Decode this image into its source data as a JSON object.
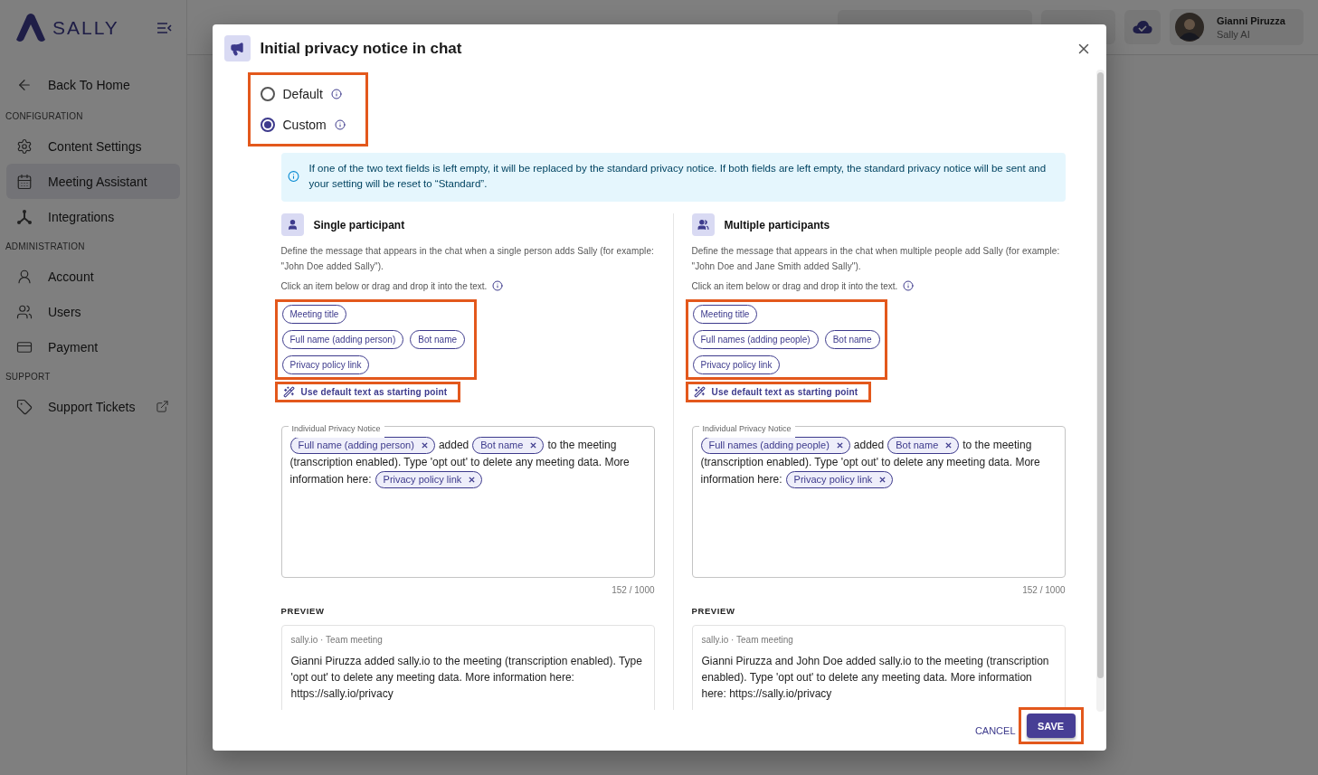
{
  "sidebar": {
    "logo": "SALLY",
    "back": {
      "label": "Back To Home"
    },
    "sections": [
      {
        "title": "CONFIGURATION",
        "items": [
          {
            "label": "Content Settings",
            "selected": false
          },
          {
            "label": "Meeting Assistant",
            "selected": true
          },
          {
            "label": "Integrations",
            "selected": false
          }
        ]
      },
      {
        "title": "ADMINISTRATION",
        "items": [
          {
            "label": "Account",
            "selected": false
          },
          {
            "label": "Users",
            "selected": false
          },
          {
            "label": "Payment",
            "selected": false
          }
        ]
      },
      {
        "title": "SUPPORT",
        "items": [
          {
            "label": "Support Tickets",
            "selected": false,
            "external": true
          }
        ]
      }
    ]
  },
  "topbar": {
    "user": {
      "name": "Gianni Piruzza",
      "role": "Sally AI"
    }
  },
  "dialog": {
    "title": "Initial privacy notice in chat",
    "radios_highlighted": true,
    "radios": [
      {
        "label": "Default",
        "selected": false
      },
      {
        "label": "Custom",
        "selected": true
      }
    ],
    "info": "If one of the two text fields is left empty, it will be replaced by the standard privacy notice. If both fields are left empty, the standard privacy notice will be sent and your setting will be reset to “Standard”.",
    "columns": [
      {
        "kind": "single",
        "title": "Single participant",
        "description": "Define the message that appears in the chat when a single person adds Sally (for example: \"John Doe added Sally\").",
        "hint": "Click an item below or drag and drop it into the text.",
        "tokens_highlighted": true,
        "tokens": [
          [
            "Meeting title"
          ],
          [
            "Full name (adding person)",
            "Bot name"
          ],
          [
            "Privacy policy link"
          ]
        ],
        "default_button": {
          "label": "Use default text as starting point",
          "highlighted": true
        },
        "editor": {
          "label": "Individual Privacy Notice",
          "lines": [
            [
              {
                "kind": "token",
                "text": "Full name (adding person)"
              },
              {
                "kind": "text",
                "text": "added"
              },
              {
                "kind": "token",
                "text": "Bot name"
              },
              {
                "kind": "text",
                "text": "to the meeting"
              }
            ],
            [
              {
                "kind": "text",
                "text": "(transcription enabled). Type 'opt out' to delete any meeting data. More"
              }
            ],
            [
              {
                "kind": "text",
                "text": "information here:"
              },
              {
                "kind": "token",
                "text": "Privacy policy link"
              }
            ]
          ]
        },
        "counter": "152 / 1000",
        "preview_label": "PREVIEW",
        "preview": {
          "meta": "sally.io · Team meeting",
          "message": "Gianni Piruzza added sally.io to the meeting (transcription enabled). Type 'opt out' to delete any meeting data. More information here: https://sally.io/privacy"
        }
      },
      {
        "kind": "multiple",
        "title": "Multiple participants",
        "description": "Define the message that appears in the chat when multiple people add Sally (for example: \"John Doe and Jane Smith added Sally\").",
        "hint": "Click an item below or drag and drop it into the text.",
        "tokens_highlighted": true,
        "tokens": [
          [
            "Meeting title"
          ],
          [
            "Full names (adding people)",
            "Bot name"
          ],
          [
            "Privacy policy link"
          ]
        ],
        "default_button": {
          "label": "Use default text as starting point",
          "highlighted": true
        },
        "editor": {
          "label": "Individual Privacy Notice",
          "lines": [
            [
              {
                "kind": "token",
                "text": "Full names (adding people)"
              },
              {
                "kind": "text",
                "text": "added"
              },
              {
                "kind": "token",
                "text": "Bot name"
              },
              {
                "kind": "text",
                "text": "to the meeting"
              }
            ],
            [
              {
                "kind": "text",
                "text": "(transcription enabled). Type 'opt out' to delete any meeting data. More"
              }
            ],
            [
              {
                "kind": "text",
                "text": "information here:"
              },
              {
                "kind": "token",
                "text": "Privacy policy link"
              }
            ]
          ]
        },
        "counter": "152 / 1000",
        "preview_label": "PREVIEW",
        "preview": {
          "meta": "sally.io · Team meeting",
          "message": "Gianni Piruzza and John Doe added sally.io to the meeting (transcription enabled). Type 'opt out' to delete any meeting data. More information here: https://sally.io/privacy"
        }
      }
    ],
    "cancel": "CANCEL",
    "save": {
      "label": "SAVE",
      "highlighted": true
    }
  }
}
